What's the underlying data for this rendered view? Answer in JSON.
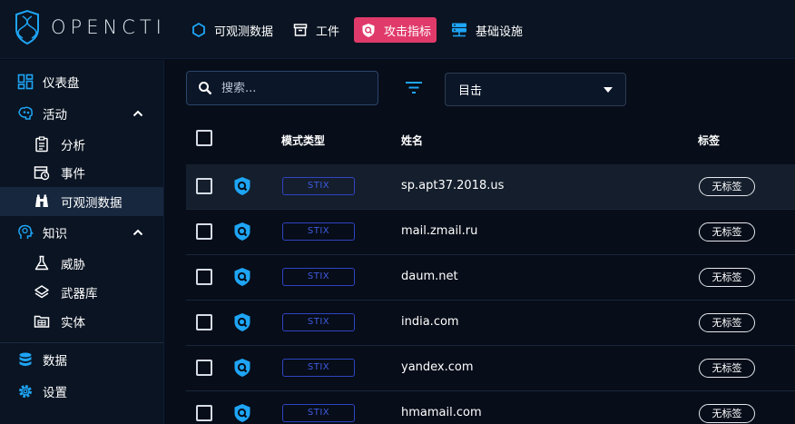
{
  "app": {
    "logo_text": "OPENCTI"
  },
  "top_nav": [
    {
      "label": "可观测数据",
      "icon": "hexagon-icon"
    },
    {
      "label": "工件",
      "icon": "archive-icon"
    },
    {
      "label": "攻击指标",
      "icon": "indicator-shield-icon",
      "active": true
    },
    {
      "label": "基础设施",
      "icon": "server-icon"
    }
  ],
  "sidebar": {
    "dashboard": "仪表盘",
    "activities": "活动",
    "analysis": "分析",
    "events": "事件",
    "observables": "可观测数据",
    "knowledge": "知识",
    "threats": "威胁",
    "arsenal": "武器库",
    "entities": "实体",
    "data": "数据",
    "settings": "设置"
  },
  "toolbar": {
    "search_placeholder": "搜索...",
    "select_value": "目击"
  },
  "table": {
    "headers": {
      "pattern_type": "模式类型",
      "name": "姓名",
      "labels": "标签"
    },
    "rows": [
      {
        "pattern_type": "STIX",
        "name": "sp.apt37.2018.us",
        "label": "无标签"
      },
      {
        "pattern_type": "STIX",
        "name": "mail.zmail.ru",
        "label": "无标签"
      },
      {
        "pattern_type": "STIX",
        "name": "daum.net",
        "label": "无标签"
      },
      {
        "pattern_type": "STIX",
        "name": "india.com",
        "label": "无标签"
      },
      {
        "pattern_type": "STIX",
        "name": "yandex.com",
        "label": "无标签"
      },
      {
        "pattern_type": "STIX",
        "name": "hmamail.com",
        "label": "无标签"
      }
    ]
  },
  "colors": {
    "background": "#070d19",
    "active_nav": "#e03a6a",
    "accent_blue": "#1ea5f5",
    "stix_border": "#2f44c2"
  }
}
